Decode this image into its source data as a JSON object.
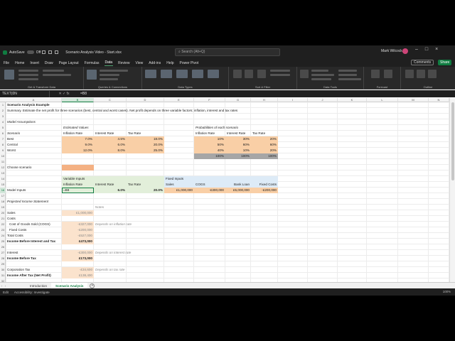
{
  "titlebar": {
    "autosave": "AutoSave",
    "autosave_state": "Off",
    "filename": "Scenario Analysis Video - Start.xlsx",
    "search": "Search (Alt+Q)",
    "user": "Mark Wilcock"
  },
  "menu": [
    "File",
    "Home",
    "Insert",
    "Draw",
    "Page Layout",
    "Formulas",
    "Data",
    "Review",
    "View",
    "Add-ins",
    "Help",
    "Power Pivot"
  ],
  "menu_active": "Data",
  "comments": "Comments",
  "share": "Share",
  "ribbon_groups": [
    "Get & Transform Data",
    "Queries & Connections",
    "Data Types",
    "Sort & Filter",
    "Data Tools",
    "Forecast",
    "Outline"
  ],
  "ribbon_buttons": {
    "get_data": "Get Data",
    "refresh_all": "Refresh All",
    "organization": "Organization",
    "stocks": "Stocks",
    "currencies": "Currencies",
    "geography": "Geography",
    "characters": "Characters",
    "sort": "Sort",
    "filter": "Filter",
    "what_if": "What-If Analysis",
    "forecast_sheet": "Forecast Sheet",
    "group": "Group",
    "ungroup": "Ungroup",
    "subtotal": "Subtotal"
  },
  "namebox": "TEXT(0N",
  "formula": "=B8",
  "columns": [
    "A",
    "B",
    "C",
    "D",
    "E",
    "F",
    "G",
    "H",
    "I",
    "J",
    "K",
    "L",
    "M",
    "N",
    "O"
  ],
  "selected_column": "B",
  "rows": [
    "1",
    "2",
    "3",
    "4",
    "5",
    "6",
    "7",
    "8",
    "9",
    "10",
    "11",
    "12",
    "13",
    "14",
    "15",
    "16",
    "17",
    "18",
    "19",
    "20",
    "21",
    "22",
    "23",
    "24",
    "25",
    "26",
    "27",
    "28",
    "29",
    "30",
    "31",
    "32"
  ],
  "selected_row": "16",
  "cells": {
    "a1": "Scenario Analysis Example",
    "a2": "Summary.  Estimate the net profit for three scenarios (best, central and worst cases).  Net profit depends on three variable factors; inflation, interest and tax rates",
    "a4": "Model Assumptions",
    "b5": "Estimated Values",
    "f5": "Probabilities of each scenario",
    "a6": "Scenario",
    "b6": "Inflation Rate",
    "c6": "Interest Rate",
    "d6": "Tax Rate",
    "f6": "Inflation Rate",
    "g6": "Interest Rate",
    "h6": "Tax Rate",
    "a7": "Best",
    "b7": "7.0%",
    "c7": "4.5%",
    "d7": "18.0%",
    "f7": "10%",
    "g7": "30%",
    "h7": "20%",
    "a8": "Central",
    "b8": "9.0%",
    "c8": "6.0%",
    "d8": "20.0%",
    "f8": "50%",
    "g8": "60%",
    "h8": "60%",
    "a9": "Worst",
    "b9": "12.0%",
    "c9": "8.0%",
    "d9": "25.0%",
    "f9": "40%",
    "g9": "10%",
    "h9": "20%",
    "f10": "100%",
    "g10": "100%",
    "h10": "100%",
    "a12": "Choose scenario",
    "b14": "Variable Inputs",
    "e14": "Fixed Inputs",
    "b15": "Inflation Rate",
    "c15": "Interest Rate",
    "d15": "Tax Rate",
    "e15": "Sales",
    "f15": "COGS",
    "g15": "Bank Loan",
    "h15": "Fixed Costs",
    "a16": "Model Inputs",
    "b16": "=B8",
    "c16": "6.0%",
    "d16": "20.0%",
    "e16": "£1,000,000",
    "f16": "-£300,000",
    "g16": "£5,000,000",
    "h16": "-£200,000",
    "a18": "Projected Income Statement",
    "c19": "Notes",
    "a20": "Sales",
    "b20": "£1,000,000",
    "a21": "Costs",
    "a22": "Cost of Goods Sold (COGS)",
    "b22": "-£327,000",
    "c22": "Depends on inflation rate",
    "a23": "Fixed Costs",
    "b23": "-£200,000",
    "a24": "Total Costs",
    "b24": "-£527,000",
    "a25": "Income Before Interest and Tax",
    "b25": "£473,000",
    "a27": "Interest",
    "b27": "-£300,000",
    "c27": "Depends on interest rate",
    "a28": "Income Before Tax",
    "b28": "£173,000",
    "a30": "Corporation  Tax",
    "b30": "-£34,600",
    "c30": "Depends on tax rate",
    "a31": "Income After Tax (Net Profit)",
    "b31": "£138,400"
  },
  "sheets": [
    "Introduction",
    "Scenario Analysis"
  ],
  "active_sheet": "Scenario Analysis",
  "status": {
    "mode": "Edit",
    "accessibility": "Accessibility: Investigate"
  },
  "zoom": "100%"
}
